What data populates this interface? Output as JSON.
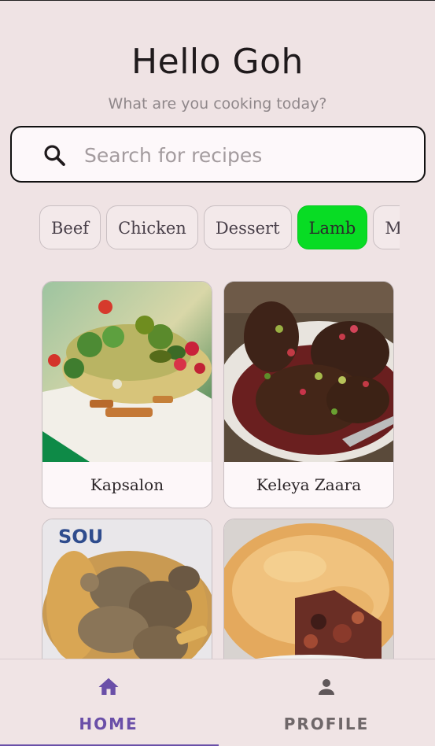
{
  "header": {
    "greeting": "Hello Goh",
    "subtitle": "What are you cooking today?"
  },
  "search": {
    "placeholder": "Search for recipes",
    "icon": "search-icon"
  },
  "categories": [
    {
      "label": "Beef",
      "selected": false
    },
    {
      "label": "Chicken",
      "selected": false
    },
    {
      "label": "Dessert",
      "selected": false
    },
    {
      "label": "Lamb",
      "selected": true
    },
    {
      "label": "Miscellaneous",
      "selected": false
    }
  ],
  "colors": {
    "background": "#efe3e4",
    "selected_chip": "#08dc24",
    "accent": "#6a4fa8"
  },
  "recipes": [
    {
      "name": "Kapsalon"
    },
    {
      "name": "Keleya Zaara"
    },
    {
      "name": ""
    },
    {
      "name": ""
    }
  ],
  "bottom_nav": {
    "home": {
      "label": "HOME",
      "icon": "home-icon",
      "active": true
    },
    "profile": {
      "label": "PROFILE",
      "icon": "person-icon",
      "active": false
    }
  }
}
